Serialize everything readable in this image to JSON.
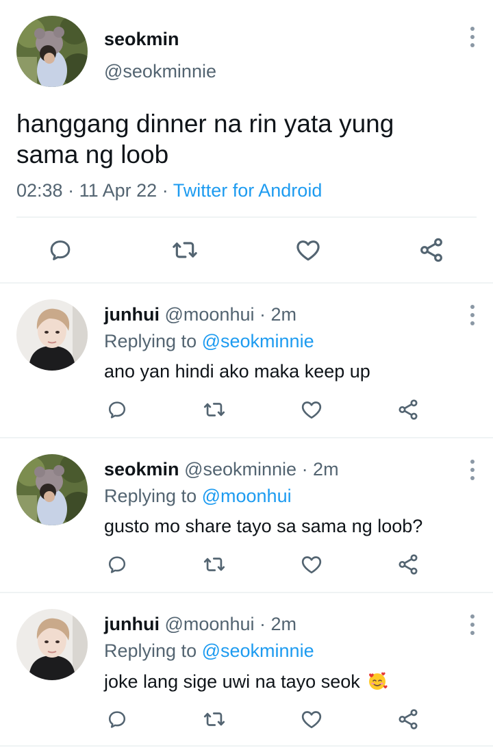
{
  "main_tweet": {
    "display_name": "seokmin",
    "handle": "@seokminnie",
    "text_line1": "hanggang dinner na rin yata yung",
    "text_line2": "sama ng loob",
    "time": "02:38",
    "date": "11 Apr 22",
    "source": "Twitter for Android",
    "separator": "·"
  },
  "replies": [
    {
      "display_name": "junhui",
      "handle": "@moonhui",
      "time": "· 2m",
      "replying_prefix": "Replying to",
      "replying_to": "@seokminnie",
      "text": "ano yan hindi ako maka keep up"
    },
    {
      "display_name": "seokmin",
      "handle": "@seokminnie",
      "time": "· 2m",
      "replying_prefix": "Replying to",
      "replying_to": "@moonhui",
      "text": "gusto mo share tayo sa sama ng loob?"
    },
    {
      "display_name": "junhui",
      "handle": "@moonhui",
      "time": "· 2m",
      "replying_prefix": "Replying to",
      "replying_to": "@seokminnie",
      "text": "joke lang sige uwi na tayo seok",
      "emoji": "🥰"
    }
  ],
  "icons": [
    "reply-icon",
    "retweet-icon",
    "like-icon",
    "share-icon",
    "more-icon"
  ],
  "colors": {
    "accent": "#1d9bf0",
    "secondary_text": "#536471",
    "icon": "#536471",
    "divider": "#eff3f4"
  }
}
